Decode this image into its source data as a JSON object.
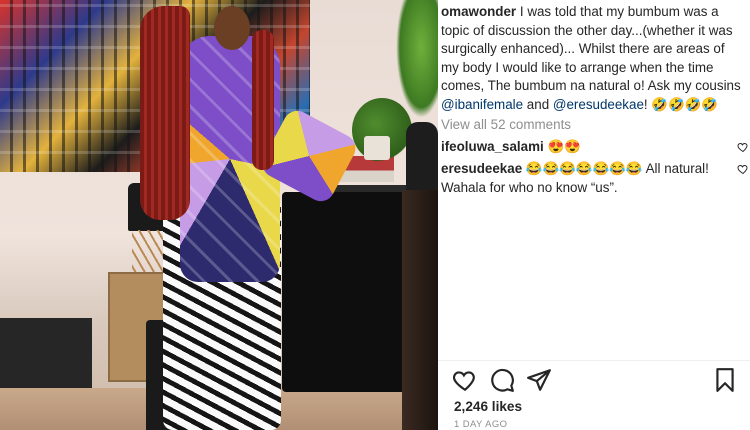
{
  "post": {
    "caption_user": "omawonder",
    "caption_text": " I was told that my bumbum was a topic of discussion the other day...(whether it was surgically enhanced)... Whilst there are areas of my body I would like to arrange when the time comes, The bumbum na natural o! Ask my cousins ",
    "mention_1": "@ibanifemale",
    "caption_and": " and ",
    "mention_2": "@eresudeekae",
    "caption_end": "! ",
    "caption_emoji": "🤣🤣🤣🤣",
    "view_all_comments": "View all 52 comments",
    "likes": "2,246 likes",
    "time": "1 DAY AGO"
  },
  "comments": [
    {
      "user": "ifeoluwa_salami",
      "text": " ",
      "emoji": "😍😍"
    },
    {
      "user": "eresudeekae",
      "text": " All natural! Wahala for who no know “us”.",
      "emoji": "😂😂😂😂😂😂😂"
    }
  ],
  "icons": {
    "like": "heart-icon",
    "comment": "comment-icon",
    "share": "share-icon",
    "save": "bookmark-icon",
    "comment_like": "heart-icon"
  },
  "colors": {
    "text": "#262626",
    "mention": "#00376b",
    "muted": "#8e8e8e"
  }
}
